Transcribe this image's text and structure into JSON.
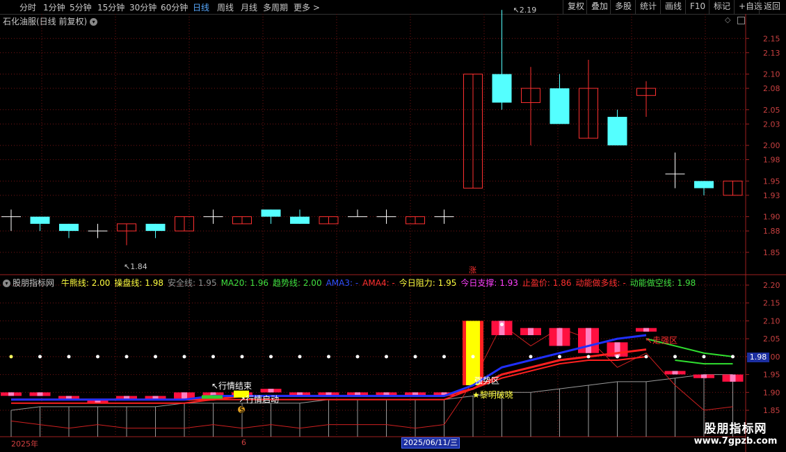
{
  "topbar": {
    "periods": [
      "分时",
      "1分钟",
      "5分钟",
      "15分钟",
      "30分钟",
      "60分钟",
      "日线",
      "周线",
      "月线",
      "多周期",
      "更多 >"
    ],
    "active_period": "日线",
    "tools": [
      "复权",
      "叠加",
      "多股",
      "统计",
      "画线",
      "F10",
      "标记",
      "+自选",
      "返回"
    ]
  },
  "main": {
    "title": "石化油服(日线 前复权)",
    "price_axis": [
      "2.15",
      "2.13",
      "2.10",
      "2.08",
      "2.05",
      "2.03",
      "2.00",
      "1.98",
      "1.95",
      "1.93",
      "1.90",
      "1.88",
      "1.85"
    ],
    "high_label": "2.19",
    "low_label": "1.84",
    "marker": "涨"
  },
  "indicator": {
    "name": "股朋指标网",
    "legend": [
      {
        "text": "牛熊线: 2.00",
        "color": "#ffff40"
      },
      {
        "text": "操盘线: 1.98",
        "color": "#ffff40"
      },
      {
        "text": "安全线: 1.95",
        "color": "#909090"
      },
      {
        "text": "MA20: 1.96",
        "color": "#40e040"
      },
      {
        "text": "趋势线: 2.00",
        "color": "#40e040"
      },
      {
        "text": "AMA3: -",
        "color": "#3050ff"
      },
      {
        "text": "AMA4: -",
        "color": "#ff3030"
      },
      {
        "text": "今日阻力: 1.95",
        "color": "#ffff40"
      },
      {
        "text": "今日支撑: 1.93",
        "color": "#ff40ff"
      },
      {
        "text": "止盈价: 1.86",
        "color": "#ff3030"
      },
      {
        "text": "动能做多线: -",
        "color": "#ff3030"
      },
      {
        "text": "动能做空线: 1.98",
        "color": "#40e040"
      }
    ],
    "axis": [
      "2.20",
      "2.15",
      "2.10",
      "2.05",
      "2.00",
      "1.95",
      "1.90",
      "1.85"
    ],
    "last_value": "1.98",
    "annotations": {
      "end": "行情结束",
      "start": "行情启动",
      "strong": "强势区",
      "strong2": "走强区",
      "dawn": "★黎明破晓",
      "coin": "$"
    }
  },
  "date_axis": {
    "year": "2025年",
    "month": "6",
    "cursor_date": "2025/06/11/三"
  },
  "watermark": {
    "line1": "股朋指标网",
    "line2": "www.7gpzb.com"
  },
  "chart_data": {
    "type": "candlestick",
    "candles": [
      {
        "o": 1.9,
        "h": 1.91,
        "l": 1.88,
        "c": 1.9
      },
      {
        "o": 1.9,
        "h": 1.9,
        "l": 1.88,
        "c": 1.89
      },
      {
        "o": 1.89,
        "h": 1.89,
        "l": 1.87,
        "c": 1.88
      },
      {
        "o": 1.88,
        "h": 1.89,
        "l": 1.87,
        "c": 1.88
      },
      {
        "o": 1.88,
        "h": 1.89,
        "l": 1.86,
        "c": 1.89
      },
      {
        "o": 1.89,
        "h": 1.89,
        "l": 1.87,
        "c": 1.88
      },
      {
        "o": 1.88,
        "h": 1.9,
        "l": 1.88,
        "c": 1.9
      },
      {
        "o": 1.9,
        "h": 1.91,
        "l": 1.89,
        "c": 1.9
      },
      {
        "o": 1.89,
        "h": 1.9,
        "l": 1.89,
        "c": 1.9
      },
      {
        "o": 1.91,
        "h": 1.91,
        "l": 1.89,
        "c": 1.9
      },
      {
        "o": 1.9,
        "h": 1.91,
        "l": 1.89,
        "c": 1.89
      },
      {
        "o": 1.89,
        "h": 1.9,
        "l": 1.89,
        "c": 1.9
      },
      {
        "o": 1.9,
        "h": 1.91,
        "l": 1.9,
        "c": 1.9
      },
      {
        "o": 1.9,
        "h": 1.91,
        "l": 1.89,
        "c": 1.9
      },
      {
        "o": 1.89,
        "h": 1.9,
        "l": 1.89,
        "c": 1.9
      },
      {
        "o": 1.9,
        "h": 1.91,
        "l": 1.89,
        "c": 1.9
      },
      {
        "o": 1.94,
        "h": 2.1,
        "l": 1.94,
        "c": 2.1
      },
      {
        "o": 2.1,
        "h": 2.19,
        "l": 2.05,
        "c": 2.06
      },
      {
        "o": 2.06,
        "h": 2.11,
        "l": 2.0,
        "c": 2.08
      },
      {
        "o": 2.08,
        "h": 2.1,
        "l": 2.03,
        "c": 2.03
      },
      {
        "o": 2.01,
        "h": 2.12,
        "l": 2.01,
        "c": 2.08
      },
      {
        "o": 2.04,
        "h": 2.05,
        "l": 2.0,
        "c": 2.0
      },
      {
        "o": 2.07,
        "h": 2.09,
        "l": 2.04,
        "c": 2.08
      },
      {
        "o": 1.96,
        "h": 1.99,
        "l": 1.94,
        "c": 1.96
      },
      {
        "o": 1.95,
        "h": 1.95,
        "l": 1.93,
        "c": 1.94
      },
      {
        "o": 1.93,
        "h": 1.95,
        "l": 1.93,
        "c": 1.95
      }
    ],
    "y_range": [
      1.83,
      2.22
    ],
    "indicator_series": {
      "blue": [
        1.88,
        1.88,
        1.88,
        1.88,
        1.88,
        1.88,
        1.88,
        1.89,
        1.89,
        1.89,
        1.89,
        1.89,
        1.89,
        1.89,
        1.89,
        1.89,
        1.92,
        1.97,
        1.99,
        2.01,
        2.03,
        2.05,
        2.06,
        null,
        null,
        null
      ],
      "red": [
        1.88,
        1.88,
        1.88,
        1.88,
        1.88,
        1.88,
        1.88,
        1.88,
        1.89,
        1.89,
        1.89,
        1.89,
        1.89,
        1.89,
        1.89,
        1.89,
        1.91,
        1.95,
        1.97,
        1.99,
        2.0,
        2.01,
        2.02,
        null,
        null,
        null
      ],
      "red2": [
        1.87,
        1.87,
        1.87,
        1.87,
        1.87,
        1.87,
        1.87,
        1.88,
        1.88,
        1.88,
        1.88,
        1.88,
        1.88,
        1.88,
        1.88,
        1.88,
        1.91,
        1.94,
        1.96,
        1.98,
        1.99,
        1.99,
        2.0,
        null,
        null,
        null
      ],
      "green": [
        null,
        null,
        null,
        null,
        null,
        null,
        null,
        null,
        null,
        null,
        null,
        null,
        null,
        null,
        null,
        null,
        null,
        null,
        null,
        null,
        null,
        null,
        2.05,
        2.03,
        2.01,
        2.0
      ],
      "green2": [
        null,
        null,
        null,
        null,
        null,
        null,
        null,
        null,
        null,
        null,
        null,
        null,
        null,
        null,
        null,
        null,
        null,
        null,
        null,
        null,
        null,
        null,
        null,
        1.99,
        1.98,
        1.98
      ],
      "gray": [
        1.85,
        1.86,
        1.86,
        1.86,
        1.86,
        1.86,
        1.87,
        1.87,
        1.87,
        1.87,
        1.87,
        1.88,
        1.88,
        1.88,
        1.88,
        1.88,
        1.89,
        1.9,
        1.9,
        1.91,
        1.92,
        1.93,
        1.93,
        1.94,
        1.95,
        1.95
      ],
      "thin_red": [
        1.82,
        1.81,
        1.8,
        1.81,
        1.8,
        1.8,
        1.8,
        1.81,
        1.8,
        1.81,
        1.8,
        1.81,
        1.81,
        1.81,
        1.8,
        1.81,
        1.93,
        2.09,
        2.03,
        2.08,
        2.05,
        1.97,
        2.01,
        1.92,
        1.85,
        1.86
      ],
      "dots": [
        2.0,
        2.0,
        2.0,
        2.0,
        2.0,
        2.0,
        2.0,
        2.0,
        2.0,
        2.0,
        2.0,
        2.0,
        2.0,
        2.0,
        2.0,
        2.0,
        2.0,
        2.09,
        2.0,
        2.0,
        2.0,
        2.0,
        2.0,
        2.0,
        2.0,
        2.0
      ]
    }
  }
}
